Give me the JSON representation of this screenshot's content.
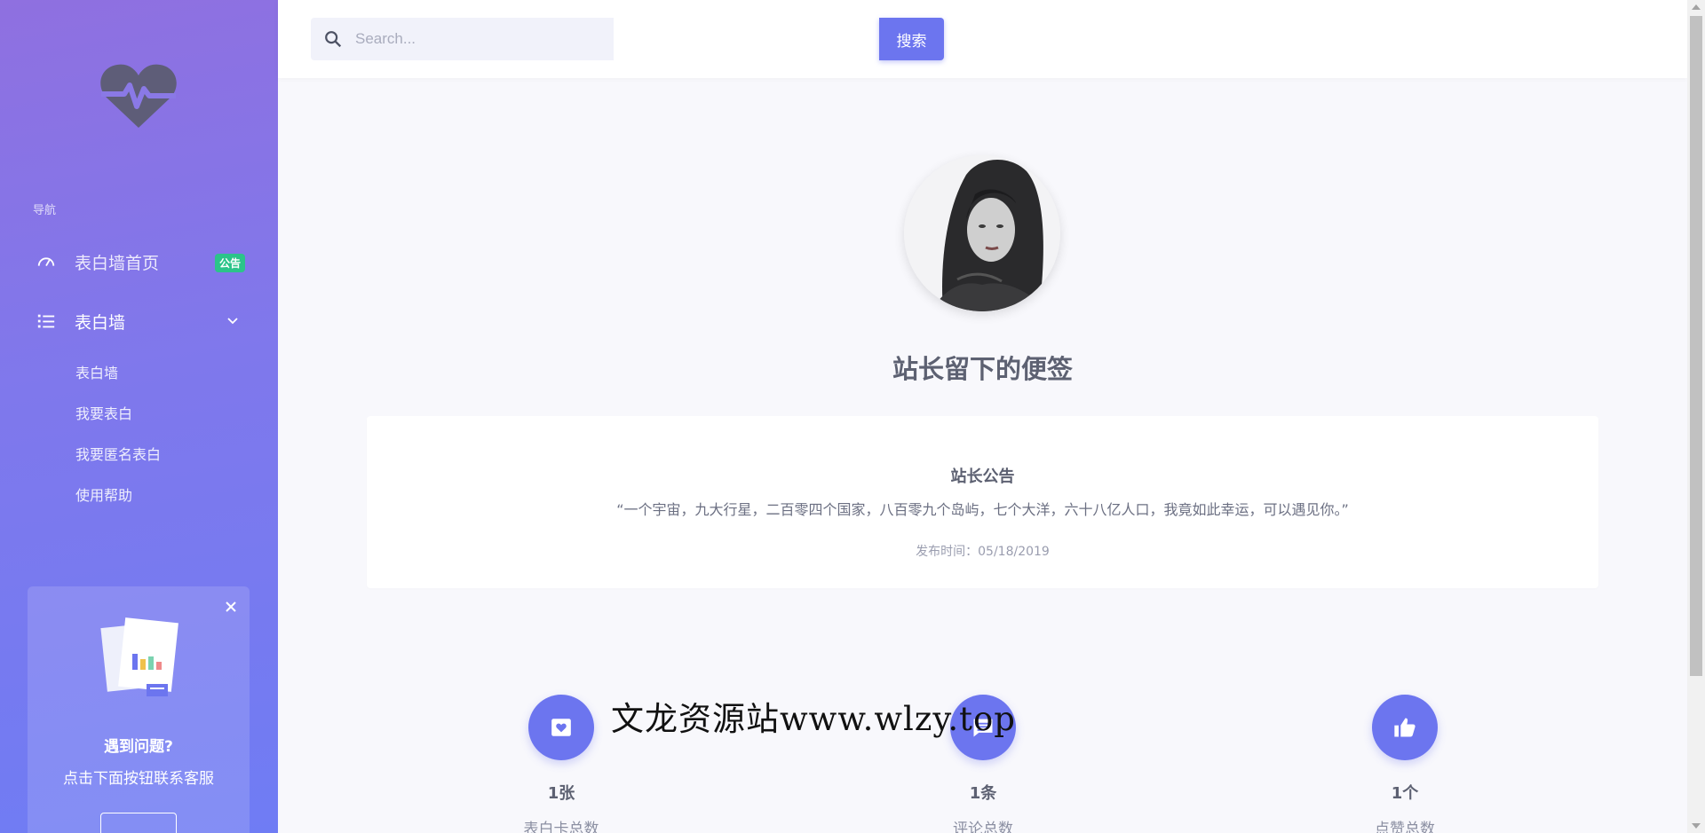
{
  "sidebar": {
    "nav_heading": "导航",
    "items": [
      {
        "label": "表白墙首页",
        "badge": "公告",
        "icon": "dashboard-gauge-icon"
      },
      {
        "label": "表白墙",
        "icon": "list-icon",
        "expanded": true
      }
    ],
    "sub_items": [
      "表白墙",
      "我要表白",
      "我要匿名表白",
      "使用帮助"
    ],
    "help_card": {
      "title": "遇到问题?",
      "subtitle": "点击下面按钮联系客服"
    }
  },
  "header": {
    "search_placeholder": "Search...",
    "search_button": "搜索"
  },
  "main": {
    "title": "站长留下的便签",
    "notice": {
      "title": "站长公告",
      "quote": "“一个宇宙，九大行星，二百零四个国家，八百零九个岛屿，七个大洋，六十八亿人口，我竟如此幸运，可以遇见你。”",
      "date": "发布时间：05/18/2019"
    },
    "stats": [
      {
        "value": "1张",
        "label": "表白卡总数",
        "icon": "heart-box-icon"
      },
      {
        "value": "1条",
        "label": "评论总数",
        "icon": "comment-icon"
      },
      {
        "value": "1个",
        "label": "点赞总数",
        "icon": "thumbs-up-icon"
      }
    ]
  },
  "watermark": "文龙资源站www.wlzy.top",
  "colors": {
    "accent": "#6c75ef",
    "badge": "#2bc48a",
    "sidebar_top": "#8f70e0",
    "sidebar_bottom": "#6f7cf4"
  }
}
